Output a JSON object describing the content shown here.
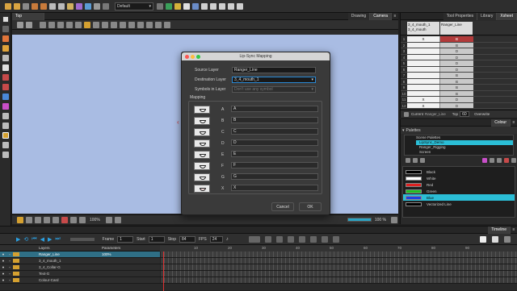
{
  "toolbar": {
    "preset_label": "Default"
  },
  "view": {
    "top_tab": "Top",
    "tab_drawing": "Drawing",
    "tab_camera": "Camera",
    "zoom": "100%",
    "zoom_right": "100 %",
    "stage_color": "#a9bce3"
  },
  "dialog": {
    "title": "Lip-Sync Mapping",
    "source_label": "Source Layer",
    "source_value": "Ranger_Line",
    "dest_label": "Destination Layer",
    "dest_value": "3_4_mouth_1",
    "symbols_label": "Symbols in Layer",
    "symbols_placeholder": "Don't use any symbol",
    "mapping_label": "Mapping",
    "mappings": [
      {
        "phoneme": "A",
        "value": "A"
      },
      {
        "phoneme": "B",
        "value": "B"
      },
      {
        "phoneme": "C",
        "value": "C"
      },
      {
        "phoneme": "D",
        "value": "D"
      },
      {
        "phoneme": "E",
        "value": "E"
      },
      {
        "phoneme": "F",
        "value": "F"
      },
      {
        "phoneme": "G",
        "value": "G"
      },
      {
        "phoneme": "X",
        "value": "X"
      }
    ],
    "cancel_label": "Cancel",
    "ok_label": "OK"
  },
  "xsheet": {
    "tab_tool_properties": "Tool Properties",
    "tab_library": "Library",
    "tab_xsheet": "Xsheet",
    "col1_line1": "3_4_mouth_1",
    "col1_line2": "3_4_mouth",
    "col2": "Ranger_Line",
    "rows": [
      {
        "n": "1",
        "c1": "X",
        "c2": "B"
      },
      {
        "n": "2",
        "c1": "",
        "c2": "B"
      },
      {
        "n": "3",
        "c1": "",
        "c2": "D"
      },
      {
        "n": "4",
        "c1": "",
        "c2": "D"
      },
      {
        "n": "5",
        "c1": "",
        "c2": "D"
      },
      {
        "n": "6",
        "c1": "",
        "c2": "D"
      },
      {
        "n": "7",
        "c1": "",
        "c2": "B"
      },
      {
        "n": "8",
        "c1": "",
        "c2": "B"
      },
      {
        "n": "9",
        "c1": "",
        "c2": "B"
      },
      {
        "n": "10",
        "c1": "",
        "c2": "B"
      },
      {
        "n": "11",
        "c1": "X",
        "c2": "D"
      },
      {
        "n": "12",
        "c1": "X",
        "c2": "D"
      }
    ],
    "current_label": "Current",
    "current_value": "Ranger_Line",
    "top_label": "Top",
    "top_value": "60",
    "overwrite_label": "Overwrite"
  },
  "colour": {
    "title": "Colour",
    "palettes_label": "Palettes",
    "scene_palettes": "Scene Palettes",
    "palette_items": [
      {
        "label": "LipSync_Demo",
        "selected": true
      },
      {
        "label": "Ranger_Rigging",
        "selected": false
      },
      {
        "label": "Screen",
        "selected": false
      }
    ],
    "swatches": [
      {
        "name": "Black",
        "hex": "#000000",
        "selected": false
      },
      {
        "name": "White",
        "hex": "#ffffff",
        "selected": false
      },
      {
        "name": "Red",
        "hex": "#e02020",
        "selected": false
      },
      {
        "name": "Green",
        "hex": "#20c020",
        "selected": false
      },
      {
        "name": "Blue",
        "hex": "#2040e0",
        "selected": true
      },
      {
        "name": "Vectorized Line",
        "hex": "#000000",
        "selected": false
      }
    ]
  },
  "timeline": {
    "title": "Timeline",
    "frame_label": "Frame",
    "frame_value": "1",
    "start_label": "Start",
    "start_value": "1",
    "stop_label": "Stop",
    "stop_value": "84",
    "fps_label": "FPS",
    "fps_value": "24",
    "layers_header": "Layers",
    "parameters_header": "Parameters",
    "layers": [
      {
        "name": "Ranger_Line",
        "selected": true
      },
      {
        "name": "3_4_mouth_1",
        "selected": false
      },
      {
        "name": "3_4_Collar-G",
        "selected": false
      },
      {
        "name": "Text-G",
        "selected": false
      },
      {
        "name": "Colour-Card",
        "selected": false
      }
    ],
    "ruler_marks": [
      "10",
      "20",
      "30",
      "40",
      "50",
      "60",
      "70",
      "80",
      "90"
    ],
    "level_value": "100%"
  }
}
